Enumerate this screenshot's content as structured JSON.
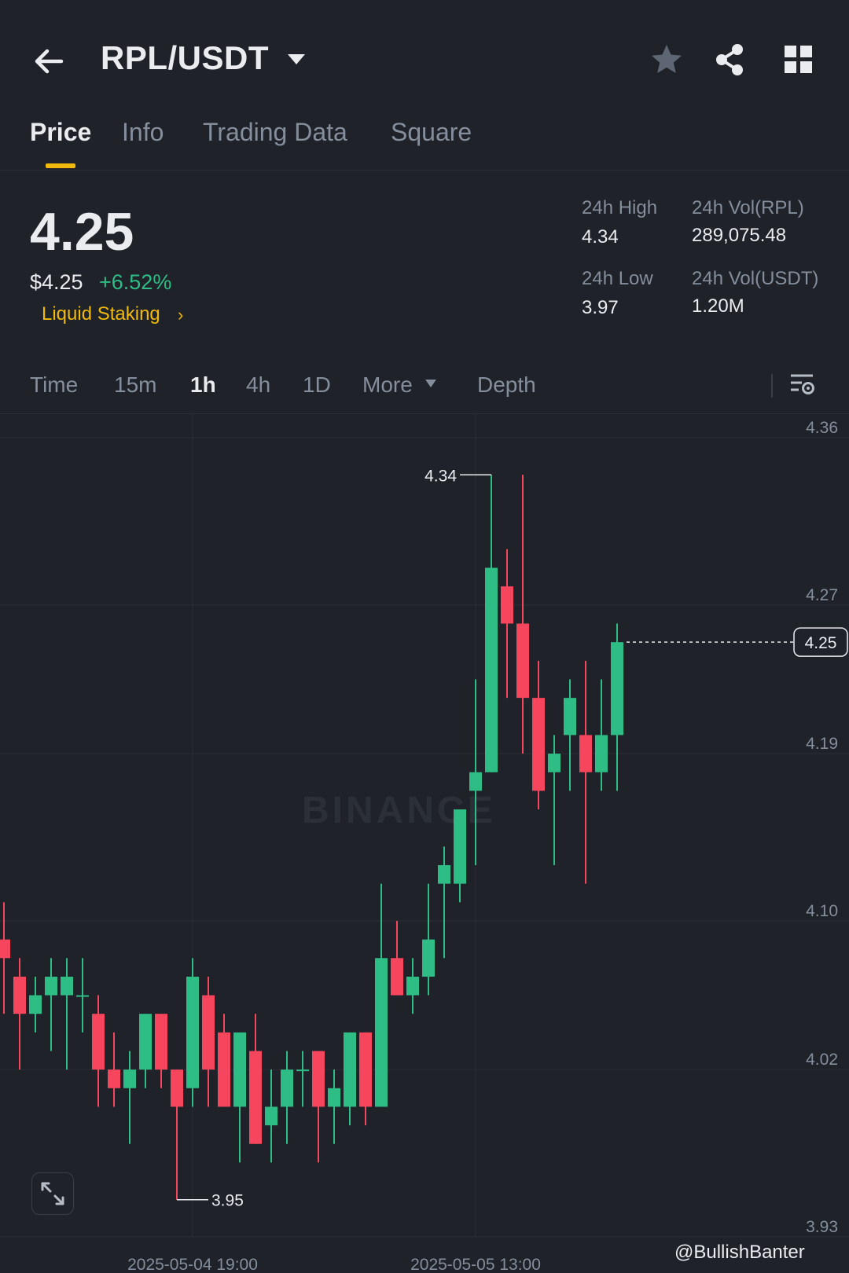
{
  "header": {
    "pair": "RPL/USDT"
  },
  "tabs": [
    {
      "label": "Price",
      "active": true
    },
    {
      "label": "Info",
      "active": false
    },
    {
      "label": "Trading Data",
      "active": false
    },
    {
      "label": "Square",
      "active": false
    }
  ],
  "ticker": {
    "last_price": "4.25",
    "usd_price": "$4.25",
    "change_pct": "+6.52%",
    "tag": "Liquid Staking",
    "stats": {
      "high_label": "24h High",
      "high_value": "4.34",
      "low_label": "24h Low",
      "low_value": "3.97",
      "vol_base_label": "24h Vol(RPL)",
      "vol_base_value": "289,075.48",
      "vol_quote_label": "24h Vol(USDT)",
      "vol_quote_value": "1.20M"
    }
  },
  "intervals": [
    {
      "label": "Time",
      "active": false
    },
    {
      "label": "15m",
      "active": false
    },
    {
      "label": "1h",
      "active": true
    },
    {
      "label": "4h",
      "active": false
    },
    {
      "label": "1D",
      "active": false
    },
    {
      "label": "More",
      "active": false
    },
    {
      "label": "Depth",
      "active": false
    }
  ],
  "colors": {
    "up": "#2ebd85",
    "down": "#f6465d",
    "accent": "#f0b90b",
    "background": "#1f2229",
    "grid": "#2b2f36"
  },
  "watermark": "BINANCE",
  "credit": "@BullishBanter",
  "chart_data": {
    "type": "candlestick",
    "interval": "1h",
    "ylim": [
      3.93,
      4.36
    ],
    "y_ticks": [
      "4.36",
      "4.27",
      "4.19",
      "4.10",
      "4.02",
      "3.93"
    ],
    "x_ticks": [
      {
        "label": "2025-05-04 19:00",
        "index": 12
      },
      {
        "label": "2025-05-05 13:00",
        "index": 30
      }
    ],
    "last_price_marker": "4.25",
    "annotations": [
      {
        "label": "4.34",
        "value": 4.34,
        "index": 31,
        "kind": "high"
      },
      {
        "label": "3.95",
        "value": 3.95,
        "index": 11,
        "kind": "low"
      }
    ],
    "candles": [
      {
        "o": 4.09,
        "h": 4.11,
        "l": 4.05,
        "c": 4.08
      },
      {
        "o": 4.07,
        "h": 4.08,
        "l": 4.02,
        "c": 4.05
      },
      {
        "o": 4.05,
        "h": 4.07,
        "l": 4.04,
        "c": 4.06
      },
      {
        "o": 4.06,
        "h": 4.08,
        "l": 4.03,
        "c": 4.07
      },
      {
        "o": 4.06,
        "h": 4.08,
        "l": 4.02,
        "c": 4.07
      },
      {
        "o": 4.06,
        "h": 4.08,
        "l": 4.04,
        "c": 4.06
      },
      {
        "o": 4.05,
        "h": 4.06,
        "l": 4.0,
        "c": 4.02
      },
      {
        "o": 4.02,
        "h": 4.04,
        "l": 4.0,
        "c": 4.01
      },
      {
        "o": 4.01,
        "h": 4.03,
        "l": 3.98,
        "c": 4.02
      },
      {
        "o": 4.02,
        "h": 4.05,
        "l": 4.01,
        "c": 4.05
      },
      {
        "o": 4.05,
        "h": 4.05,
        "l": 4.01,
        "c": 4.02
      },
      {
        "o": 4.02,
        "h": 4.02,
        "l": 3.95,
        "c": 4.0
      },
      {
        "o": 4.01,
        "h": 4.08,
        "l": 4.0,
        "c": 4.07
      },
      {
        "o": 4.06,
        "h": 4.07,
        "l": 4.0,
        "c": 4.02
      },
      {
        "o": 4.04,
        "h": 4.05,
        "l": 4.0,
        "c": 4.0
      },
      {
        "o": 4.0,
        "h": 4.03,
        "l": 3.97,
        "c": 4.04
      },
      {
        "o": 4.03,
        "h": 4.05,
        "l": 3.98,
        "c": 3.98
      },
      {
        "o": 3.99,
        "h": 4.02,
        "l": 3.97,
        "c": 4.0
      },
      {
        "o": 4.0,
        "h": 4.03,
        "l": 3.98,
        "c": 4.02
      },
      {
        "o": 4.02,
        "h": 4.03,
        "l": 4.0,
        "c": 4.02
      },
      {
        "o": 4.03,
        "h": 4.03,
        "l": 3.97,
        "c": 4.0
      },
      {
        "o": 4.0,
        "h": 4.02,
        "l": 3.98,
        "c": 4.01
      },
      {
        "o": 4.0,
        "h": 4.04,
        "l": 3.99,
        "c": 4.04
      },
      {
        "o": 4.04,
        "h": 4.04,
        "l": 3.99,
        "c": 4.0
      },
      {
        "o": 4.0,
        "h": 4.12,
        "l": 4.0,
        "c": 4.08
      },
      {
        "o": 4.08,
        "h": 4.1,
        "l": 4.06,
        "c": 4.06
      },
      {
        "o": 4.06,
        "h": 4.08,
        "l": 4.05,
        "c": 4.07
      },
      {
        "o": 4.07,
        "h": 4.12,
        "l": 4.06,
        "c": 4.09
      },
      {
        "o": 4.12,
        "h": 4.14,
        "l": 4.08,
        "c": 4.13
      },
      {
        "o": 4.12,
        "h": 4.16,
        "l": 4.11,
        "c": 4.16
      },
      {
        "o": 4.17,
        "h": 4.23,
        "l": 4.13,
        "c": 4.18
      },
      {
        "o": 4.18,
        "h": 4.34,
        "l": 4.18,
        "c": 4.29
      },
      {
        "o": 4.28,
        "h": 4.3,
        "l": 4.22,
        "c": 4.26
      },
      {
        "o": 4.26,
        "h": 4.34,
        "l": 4.19,
        "c": 4.22
      },
      {
        "o": 4.22,
        "h": 4.24,
        "l": 4.16,
        "c": 4.17
      },
      {
        "o": 4.18,
        "h": 4.2,
        "l": 4.13,
        "c": 4.19
      },
      {
        "o": 4.2,
        "h": 4.23,
        "l": 4.17,
        "c": 4.22
      },
      {
        "o": 4.2,
        "h": 4.24,
        "l": 4.12,
        "c": 4.18
      },
      {
        "o": 4.18,
        "h": 4.23,
        "l": 4.17,
        "c": 4.2
      },
      {
        "o": 4.2,
        "h": 4.26,
        "l": 4.17,
        "c": 4.25
      }
    ]
  }
}
